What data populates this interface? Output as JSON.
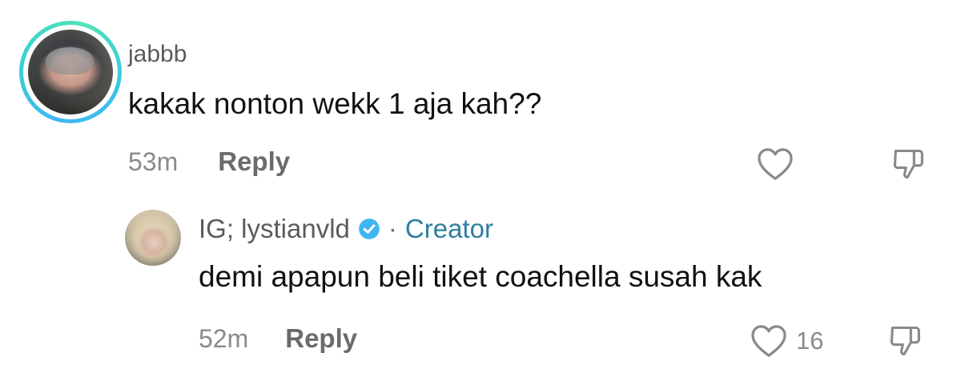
{
  "comment": {
    "username": "jabbb",
    "text": "kakak nonton wekk 1 aja kah??",
    "time": "53m",
    "reply_label": "Reply",
    "avatar_icon": "user-avatar-ring",
    "ring_colors": [
      "#3fb6f2",
      "#4fe3b6"
    ]
  },
  "reply": {
    "username": "IG; lystianvld",
    "separator": "·",
    "badge": "Creator",
    "badge_color": "#2f7fa0",
    "verified_color": "#3fb6f2",
    "text": "demi apapun beli tiket coachella susah kak",
    "time": "52m",
    "reply_label": "Reply",
    "like_count": "16"
  },
  "icons": {
    "like": "heart-outline-icon",
    "dislike": "thumbs-down-outline-icon",
    "verified": "verified-check-icon"
  }
}
